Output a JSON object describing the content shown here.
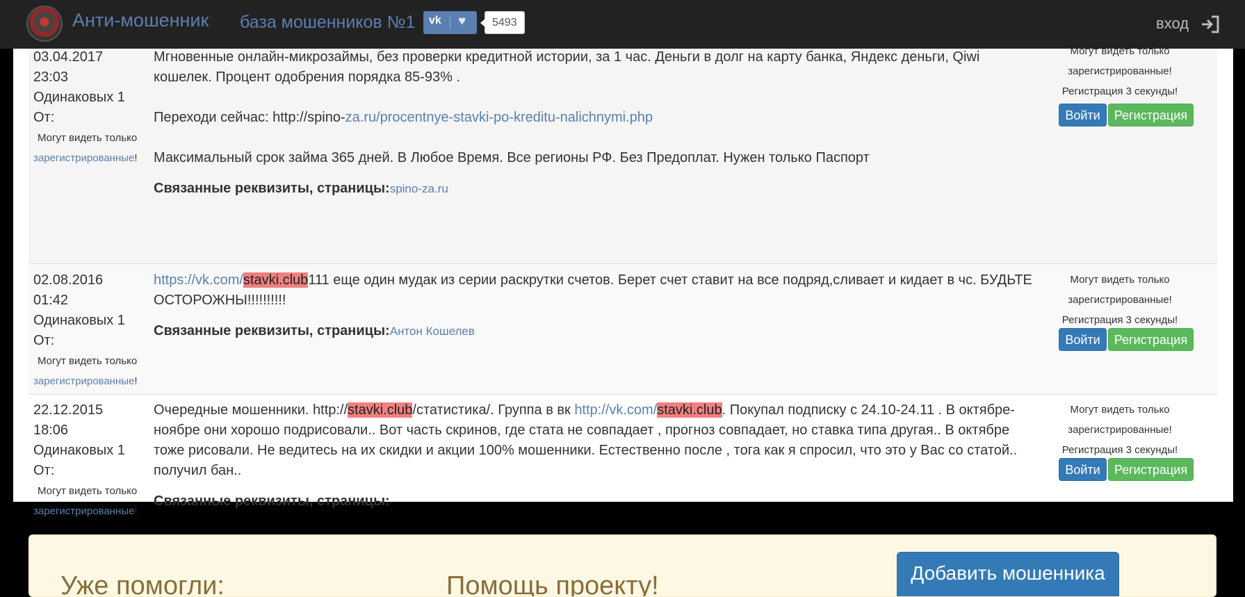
{
  "header": {
    "brand": "Анти-мошенник",
    "tagline": "база мошенников №1",
    "vk_logo": "vk",
    "vk_count": "5493",
    "login": "вход",
    "icons": {
      "logo": "site-logo",
      "vk": "vk-icon",
      "like": "heart-icon",
      "login": "sign-in-icon"
    }
  },
  "records": [
    {
      "date": "03.04.2017",
      "time": "23:03",
      "same": "Одинаковых 1",
      "from": "От:",
      "from_note": "Могут видеть только",
      "from_link": "зарегистрированные",
      "from_tail": "!",
      "line1": "Мгновенные онлайн-микрозаймы, без проверки кредитной истории, за 1 час. Деньги в долг на карту банка, Яндекс деньги, Qiwi кошелек. Процент одобрения порядка 85-93% .",
      "line2_prefix": "Переходи сейчас: http://spino-",
      "line2_link": "za.ru/procentnye-stavki-po-kreditu-nalichnymi.php",
      "line3": "Максимальный срок займа 365 дней. В Любое Время. Все регионы РФ. Без Предоплат. Нужен только Паспорт",
      "related_label": "Связанные реквизиты, страницы:",
      "related_value": "spino-za.ru"
    },
    {
      "date": "02.08.2016",
      "time": "01:42",
      "same": "Одинаковых 1",
      "from": "От:",
      "from_note": "Могут видеть только",
      "from_link": "зарегистрированные",
      "from_tail": "!",
      "link": "https://vk.com/",
      "highlight": "stavki.club",
      "after": "111 еще один мудак из серии раскрутки счетов. Берет счет ставит на все подряд,сливает и кидает в чс. БУДЬТЕ ОСТОРОЖНЫ!!!!!!!!!!",
      "related_label": "Связанные реквизиты, страницы:",
      "related_value": "Антон Кошелев"
    },
    {
      "date": "22.12.2015",
      "time": "18:06",
      "same": "Одинаковых 1",
      "from": "От:",
      "from_note": "Могут видеть только",
      "from_link": "зарегистрированные",
      "from_tail": "!",
      "t1": "Очередные мошенники. http://",
      "hl1": "stavki.club",
      "t2": "/статистика/. Группа в вк ",
      "link": "http://vk.com/",
      "hl2": "stavki.club",
      "t3": ". Покупал подписку с 24.10-24.11 . В октябре- ноябре они хорошо подрисовали.. Вот часть скринов, где стата не совпадает , прогноз совпадает, но ставка типа другая.. В октябре тоже рисовали. Не ведитесь на их скидки и акции 100% мошенники. Естественно после , тога как я спросил, что это у Вас со статой.. получил бан..",
      "related_label": "Связанные реквизиты, страницы:"
    }
  ],
  "side": {
    "line1": "Могут видеть только",
    "line2": "зарегистрированные!",
    "line3": "Регистрация 3 секунды!",
    "login_btn": "Войти",
    "register_btn": "Регистрация"
  },
  "footer": {
    "helped": "Уже помогли:",
    "help": "Помощь проекту!",
    "add_btn": "Добавить мошенника"
  },
  "colors": {
    "navbar": "#222222",
    "link": "#5b7fb0",
    "highlight": "#f08080",
    "login_button": "#337ab7",
    "register_button": "#5cb85c",
    "footer_bg": "#fcf8e3"
  }
}
